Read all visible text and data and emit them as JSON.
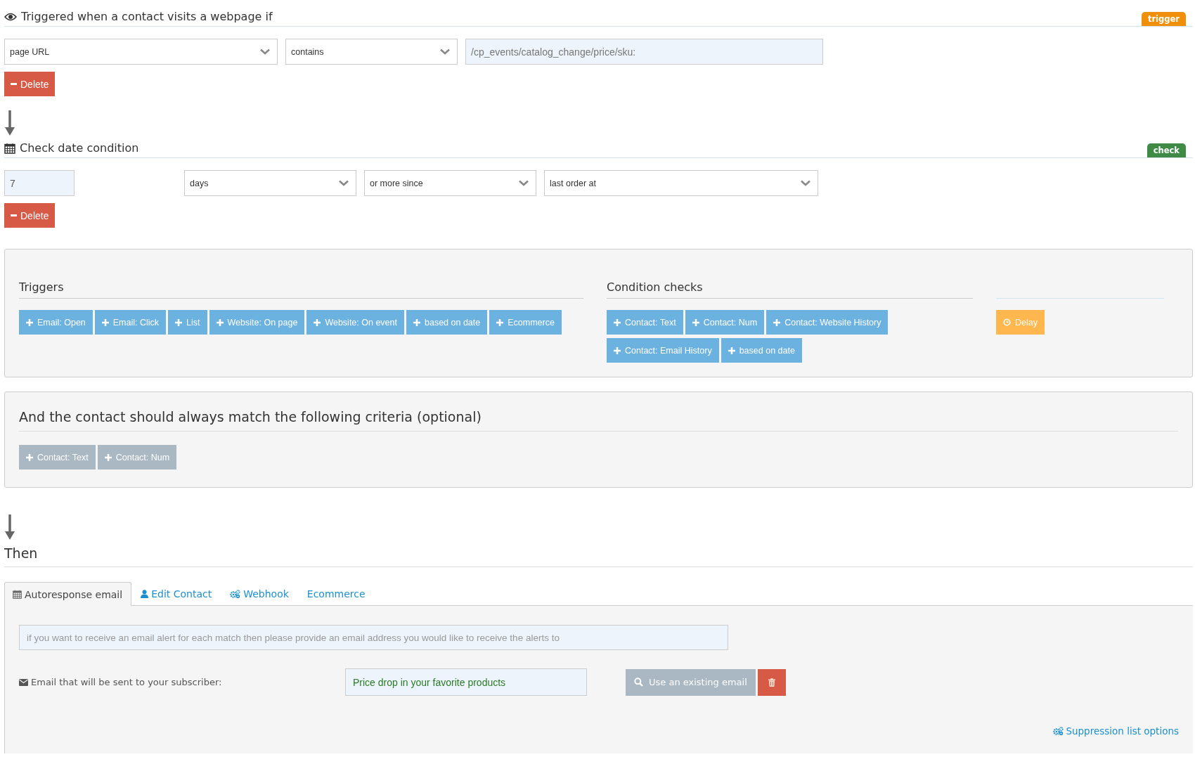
{
  "steps": [
    {
      "kind": "trigger",
      "title": "Triggered when a contact visits a webpage if",
      "badge": {
        "label": "trigger",
        "color": "#f0900a"
      },
      "fields": [
        {
          "kind": "select",
          "value": "page URL"
        },
        {
          "kind": "select",
          "value": "contains"
        },
        {
          "kind": "input",
          "value": "/cp_events/catalog_change/price/sku:"
        }
      ],
      "delete": "Delete"
    },
    {
      "kind": "check",
      "title": "Check date condition",
      "badge": {
        "label": "check",
        "color": "#3f8a45"
      },
      "fields": [
        {
          "kind": "input",
          "value": "7"
        },
        {
          "kind": "select",
          "value": "days"
        },
        {
          "kind": "select",
          "value": "or more since"
        },
        {
          "kind": "select",
          "value": "last order at"
        }
      ],
      "delete": "Delete"
    }
  ],
  "builder": {
    "sections": [
      {
        "title": "Triggers",
        "buttons": [
          {
            "kind": "add",
            "label": "Email: Open"
          },
          {
            "kind": "add",
            "label": "Email: Click"
          },
          {
            "kind": "add",
            "label": "List"
          },
          {
            "kind": "add",
            "label": "Website: On page"
          },
          {
            "kind": "add",
            "label": "Website: On event"
          },
          {
            "kind": "add",
            "label": "based on date"
          },
          {
            "kind": "add",
            "label": "Ecommerce"
          }
        ]
      },
      {
        "title": "Condition checks",
        "buttons": [
          {
            "kind": "add",
            "label": "Contact: Text"
          },
          {
            "kind": "add",
            "label": "Contact: Num"
          },
          {
            "kind": "add",
            "label": "Contact: Website History"
          },
          {
            "kind": "add",
            "label": "Contact: Email History"
          },
          {
            "kind": "add",
            "label": "based on date"
          }
        ]
      },
      {
        "buttons": [
          {
            "kind": "delay",
            "label": "Delay"
          }
        ]
      }
    ]
  },
  "criteria": {
    "title": "And the contact should always match the following criteria (optional)",
    "buttons": [
      {
        "kind": "add",
        "label": "Contact: Text",
        "disabled": true
      },
      {
        "kind": "add",
        "label": "Contact: Num",
        "disabled": true
      }
    ]
  },
  "then": {
    "title": "Then",
    "tabs": [
      {
        "label": "Autoresponse email",
        "selected": true
      },
      {
        "label": "Edit Contact",
        "selected": false
      },
      {
        "label": "Webhook",
        "selected": false
      },
      {
        "label": "Ecommerce",
        "selected": false
      }
    ],
    "alert_field": {
      "placeholder": "if you want to receive an email alert for each match then please provide an email address you would like to receive the alerts to"
    },
    "subscriber_label": "Email that will be sent to your subscriber:",
    "subject": "Price drop in your favorite products",
    "use_existing": "Use an existing email",
    "suppression_link": "Suppression list options"
  }
}
